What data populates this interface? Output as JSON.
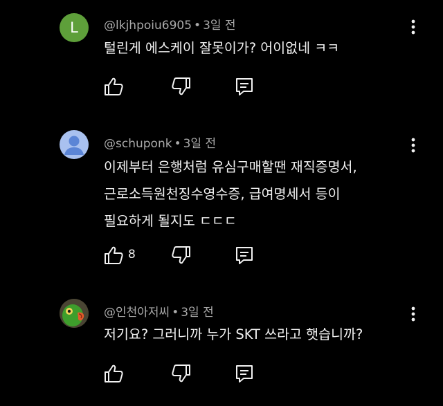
{
  "comments": [
    {
      "avatar_letter": "L",
      "author": "@lkjhpoiu6905",
      "time": "3일 전",
      "lines": [
        "털린게 에스케이 잘못이가? 어이없네 ㅋㅋ"
      ],
      "like_count": ""
    },
    {
      "author": "@schuponk",
      "time": "3일 전",
      "lines": [
        "이제부터 은행처럼 유심구매할땐 재직증명서,",
        "근로소득원천징수영수증, 급여명세서 등이",
        "필요하게 될지도 ㄷㄷㄷ"
      ],
      "like_count": "8"
    },
    {
      "author": "@인천아저씨",
      "time": "3일 전",
      "lines": [
        "저기요? 그러니까 누가 SKT 쓰라고 햇습니까?"
      ],
      "like_count": ""
    }
  ],
  "separator": "•",
  "colors": {
    "background": "#000000",
    "text": "#f1f1f1",
    "meta": "#aaaaaa",
    "avatar_l": "#5e9f3a",
    "avatar_person": "#a9c1ef"
  }
}
